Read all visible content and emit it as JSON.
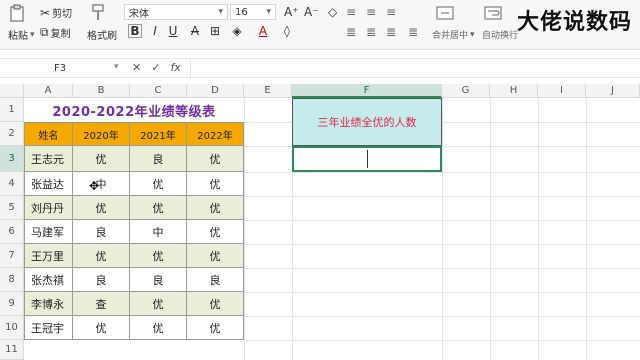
{
  "toolbar": {
    "cut_label": "剪切",
    "paste_label": "粘贴",
    "copy_label": "复制",
    "format_painter_label": "格式刷",
    "font_name": "宋体",
    "font_size": "16",
    "merge_label": "合并居中",
    "wrap_label": "自动换行"
  },
  "watermark": "大佬说数码",
  "formula_bar": {
    "name_box": "F3",
    "cancel_icon": "✕",
    "confirm_icon": "✓",
    "fx_icon": "fx",
    "value": ""
  },
  "columns": [
    "A",
    "B",
    "C",
    "D",
    "E",
    "F",
    "G",
    "H",
    "I",
    "J"
  ],
  "rows": [
    "1",
    "2",
    "3",
    "4",
    "5",
    "6",
    "7",
    "8",
    "9",
    "10",
    "11"
  ],
  "sheet": {
    "title": "2020-2022年业绩等级表",
    "headers": [
      "姓名",
      "2020年",
      "2021年",
      "2022年"
    ],
    "data": [
      [
        "王志元",
        "优",
        "良",
        "优"
      ],
      [
        "张益达",
        "中",
        "优",
        "优"
      ],
      [
        "刘丹丹",
        "优",
        "优",
        "优"
      ],
      [
        "马建军",
        "良",
        "中",
        "优"
      ],
      [
        "王万里",
        "优",
        "优",
        "优"
      ],
      [
        "张杰祺",
        "良",
        "良",
        "良"
      ],
      [
        "李博永",
        "查",
        "优",
        "优"
      ],
      [
        "王冠宇",
        "优",
        "优",
        "优"
      ]
    ]
  },
  "result": {
    "label": "三年业绩全优的人数",
    "value": ""
  },
  "colors": {
    "header_orange": "#f5a800",
    "alt_row": "#e9eed9",
    "title_purple": "#7030a0",
    "label_bg": "#c5ebec",
    "label_red": "#e0264a",
    "select_green": "#2e8b57"
  }
}
